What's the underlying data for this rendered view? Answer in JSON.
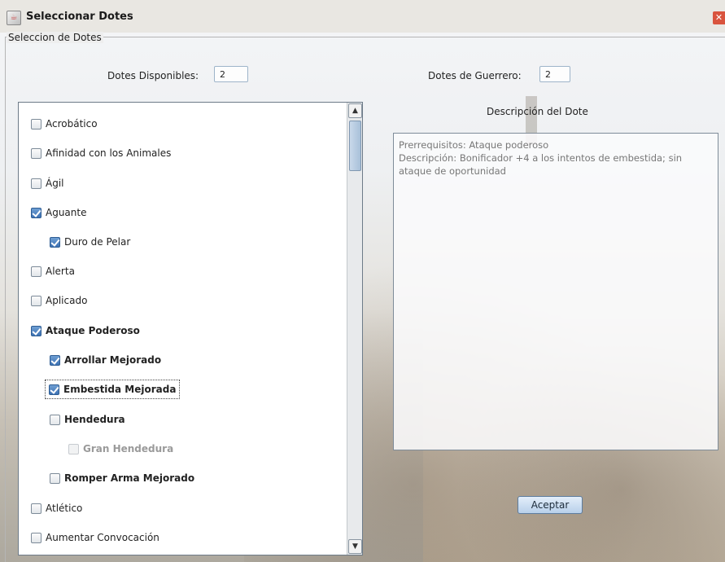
{
  "window": {
    "title": "Seleccionar Dotes",
    "close_glyph": "✕"
  },
  "group": {
    "title": "Seleccion de Dotes"
  },
  "available": {
    "label": "Dotes Disponibles:",
    "value": "2"
  },
  "warrior": {
    "label": "Dotes de Guerrero:",
    "value": "2"
  },
  "feats": [
    {
      "label": "Acrobático",
      "checked": false,
      "bold": false,
      "disabled": false
    },
    {
      "label": "Afinidad con los Animales",
      "checked": false,
      "bold": false,
      "disabled": false
    },
    {
      "label": "Ágil",
      "checked": false,
      "bold": false,
      "disabled": false
    },
    {
      "label": "Aguante",
      "checked": true,
      "bold": false,
      "disabled": false
    },
    {
      "label": "Duro de Pelar",
      "checked": true,
      "bold": false,
      "disabled": false
    },
    {
      "label": "Alerta",
      "checked": false,
      "bold": false,
      "disabled": false
    },
    {
      "label": "Aplicado",
      "checked": false,
      "bold": false,
      "disabled": false
    },
    {
      "label": "Ataque Poderoso",
      "checked": true,
      "bold": true,
      "disabled": false
    },
    {
      "label": "Arrollar Mejorado",
      "checked": true,
      "bold": true,
      "disabled": false
    },
    {
      "label": "Embestida Mejorada",
      "checked": true,
      "bold": true,
      "disabled": false,
      "focused": true
    },
    {
      "label": "Hendedura",
      "checked": false,
      "bold": true,
      "disabled": false
    },
    {
      "label": "Gran Hendedura",
      "checked": false,
      "bold": true,
      "disabled": true
    },
    {
      "label": "Romper Arma Mejorado",
      "checked": false,
      "bold": true,
      "disabled": false
    },
    {
      "label": "Atlético",
      "checked": false,
      "bold": false,
      "disabled": false
    },
    {
      "label": "Aumentar Convocación",
      "checked": false,
      "bold": false,
      "disabled": false
    }
  ],
  "scroll": {
    "up_glyph": "▲",
    "down_glyph": "▼"
  },
  "description": {
    "title": "Descripción del Dote",
    "prereq": "Prerrequisitos: Ataque poderoso",
    "text": "Descripción: Bonificador +4 a los intentos de embestida; sin ataque de oportunidad"
  },
  "accept_label": "Aceptar",
  "colors": {
    "accent": "#3d72b4",
    "title_bar": "#e9e7e2",
    "close": "#d9543e"
  },
  "icons": {
    "app": "java-cup-icon",
    "close": "close-icon",
    "scroll_up": "chevron-up-icon",
    "scroll_down": "chevron-down-icon"
  }
}
